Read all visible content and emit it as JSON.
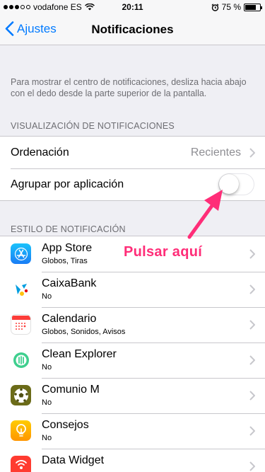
{
  "status_bar": {
    "carrier": "vodafone ES",
    "time": "20:11",
    "battery": "75 %",
    "battery_level": 0.75
  },
  "nav": {
    "back_label": "Ajustes",
    "title": "Notificaciones"
  },
  "intro_text": "Para mostrar el centro de notificaciones, desliza hacia abajo con el dedo desde la parte superior de la pantalla.",
  "display_section": {
    "header": "VISUALIZACIÓN DE NOTIFICACIONES",
    "sort_label": "Ordenación",
    "sort_value": "Recientes",
    "group_label": "Agrupar por aplicación",
    "group_enabled": false
  },
  "style_section": {
    "header": "ESTILO DE NOTIFICACIÓN"
  },
  "apps": [
    {
      "name": "App Store",
      "sub": "Globos, Tiras",
      "icon": "app-store-icon",
      "color": "#1a8cf5"
    },
    {
      "name": "CaixaBank",
      "sub": "No",
      "icon": "caixabank-icon",
      "color": "#ffffff"
    },
    {
      "name": "Calendario",
      "sub": "Globos, Sonidos, Avisos",
      "icon": "calendar-icon",
      "color": "#ffffff"
    },
    {
      "name": "Clean Explorer",
      "sub": "No",
      "icon": "clean-explorer-icon",
      "color": "#ffffff"
    },
    {
      "name": "Comunio M",
      "sub": "No",
      "icon": "comunio-icon",
      "color": "#6b6b18"
    },
    {
      "name": "Consejos",
      "sub": "No",
      "icon": "tips-lightbulb-icon",
      "color": "#ffb300"
    },
    {
      "name": "Data Widget",
      "sub": "",
      "icon": "data-widget-icon",
      "color": "#ff3b30"
    }
  ],
  "annotation": {
    "text": "Pulsar aquí",
    "color": "#ff2d78"
  },
  "colors": {
    "accent": "#007aff",
    "background": "#efeff4",
    "secondary_text": "#6d6d72"
  }
}
